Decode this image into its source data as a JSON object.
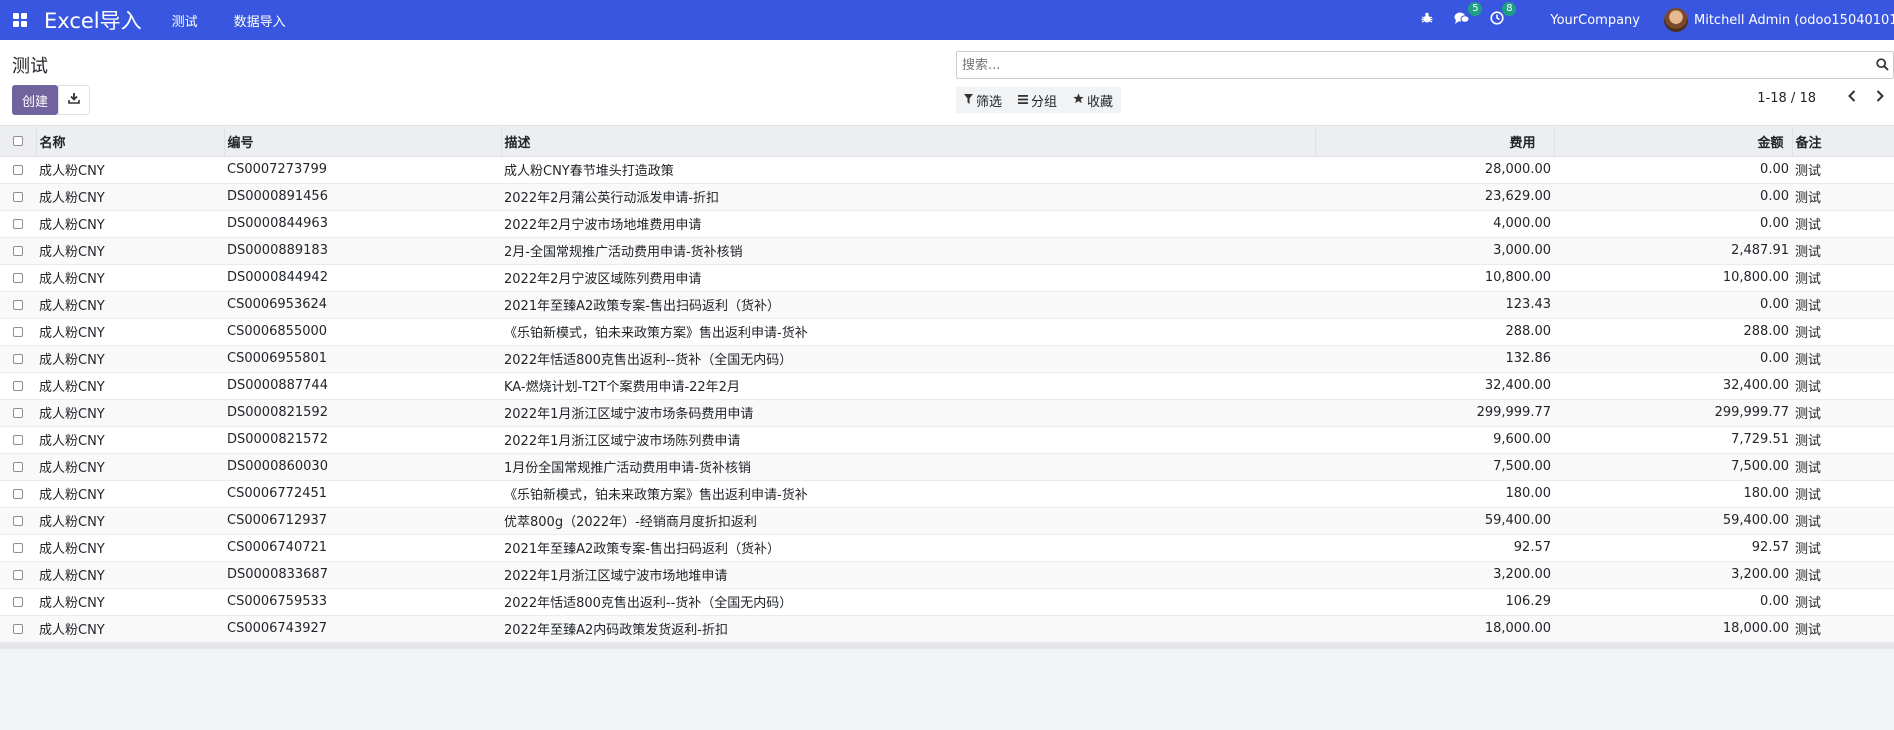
{
  "navbar": {
    "brand": "Excel导入",
    "menu": [
      "测试",
      "数据导入"
    ],
    "messages_count": "5",
    "activities_count": "8",
    "company": "YourCompany",
    "user": "Mitchell Admin (odoo15040101"
  },
  "control_panel": {
    "breadcrumb": "测试",
    "create_label": "创建",
    "search_placeholder": "搜索...",
    "filter_label": "筛选",
    "group_label": "分组",
    "favorites_label": "收藏",
    "pager_value": "1-18 / 18"
  },
  "table": {
    "columns": [
      "名称",
      "编号",
      "描述",
      "费用",
      "金额",
      "备注"
    ],
    "rows": [
      [
        "成人粉CNY",
        "CS0007273799",
        "成人粉CNY春节堆头打造政策",
        "28,000.00",
        "0.00",
        "测试"
      ],
      [
        "成人粉CNY",
        "DS0000891456",
        "2022年2月蒲公英行动派发申请-折扣",
        "23,629.00",
        "0.00",
        "测试"
      ],
      [
        "成人粉CNY",
        "DS0000844963",
        "2022年2月宁波市场地堆费用申请",
        "4,000.00",
        "0.00",
        "测试"
      ],
      [
        "成人粉CNY",
        "DS0000889183",
        "2月-全国常规推广活动费用申请-货补核销",
        "3,000.00",
        "2,487.91",
        "测试"
      ],
      [
        "成人粉CNY",
        "DS0000844942",
        "2022年2月宁波区域陈列费用申请",
        "10,800.00",
        "10,800.00",
        "测试"
      ],
      [
        "成人粉CNY",
        "CS0006953624",
        "2021年至臻A2政策专案-售出扫码返利（货补）",
        "123.43",
        "0.00",
        "测试"
      ],
      [
        "成人粉CNY",
        "CS0006855000",
        "《乐铂新模式，铂未来政策方案》售出返利申请-货补",
        "288.00",
        "288.00",
        "测试"
      ],
      [
        "成人粉CNY",
        "CS0006955801",
        "2022年恬适800克售出返利--货补（全国无内码）",
        "132.86",
        "0.00",
        "测试"
      ],
      [
        "成人粉CNY",
        "DS0000887744",
        "KA-燃烧计划-T2T个案费用申请-22年2月",
        "32,400.00",
        "32,400.00",
        "测试"
      ],
      [
        "成人粉CNY",
        "DS0000821592",
        "2022年1月浙江区域宁波市场条码费用申请",
        "299,999.77",
        "299,999.77",
        "测试"
      ],
      [
        "成人粉CNY",
        "DS0000821572",
        "2022年1月浙江区域宁波市场陈列费申请",
        "9,600.00",
        "7,729.51",
        "测试"
      ],
      [
        "成人粉CNY",
        "DS0000860030",
        "1月份全国常规推广活动费用申请-货补核销",
        "7,500.00",
        "7,500.00",
        "测试"
      ],
      [
        "成人粉CNY",
        "CS0006772451",
        "《乐铂新模式，铂未来政策方案》售出返利申请-货补",
        "180.00",
        "180.00",
        "测试"
      ],
      [
        "成人粉CNY",
        "CS0006712937",
        "优萃800g（2022年）-经销商月度折扣返利",
        "59,400.00",
        "59,400.00",
        "测试"
      ],
      [
        "成人粉CNY",
        "CS0006740721",
        "2021年至臻A2政策专案-售出扫码返利（货补）",
        "92.57",
        "92.57",
        "测试"
      ],
      [
        "成人粉CNY",
        "DS0000833687",
        "2022年1月浙江区域宁波市场地堆申请",
        "3,200.00",
        "3,200.00",
        "测试"
      ],
      [
        "成人粉CNY",
        "CS0006759533",
        "2022年恬适800克售出返利--货补（全国无内码）",
        "106.29",
        "0.00",
        "测试"
      ],
      [
        "成人粉CNY",
        "CS0006743927",
        "2022年至臻A2内码政策发货返利-折扣",
        "18,000.00",
        "18,000.00",
        "测试"
      ]
    ]
  },
  "colors": {
    "navbar": "#3956e0",
    "primary_button": "#71639e",
    "badge": "#1e9e83"
  }
}
